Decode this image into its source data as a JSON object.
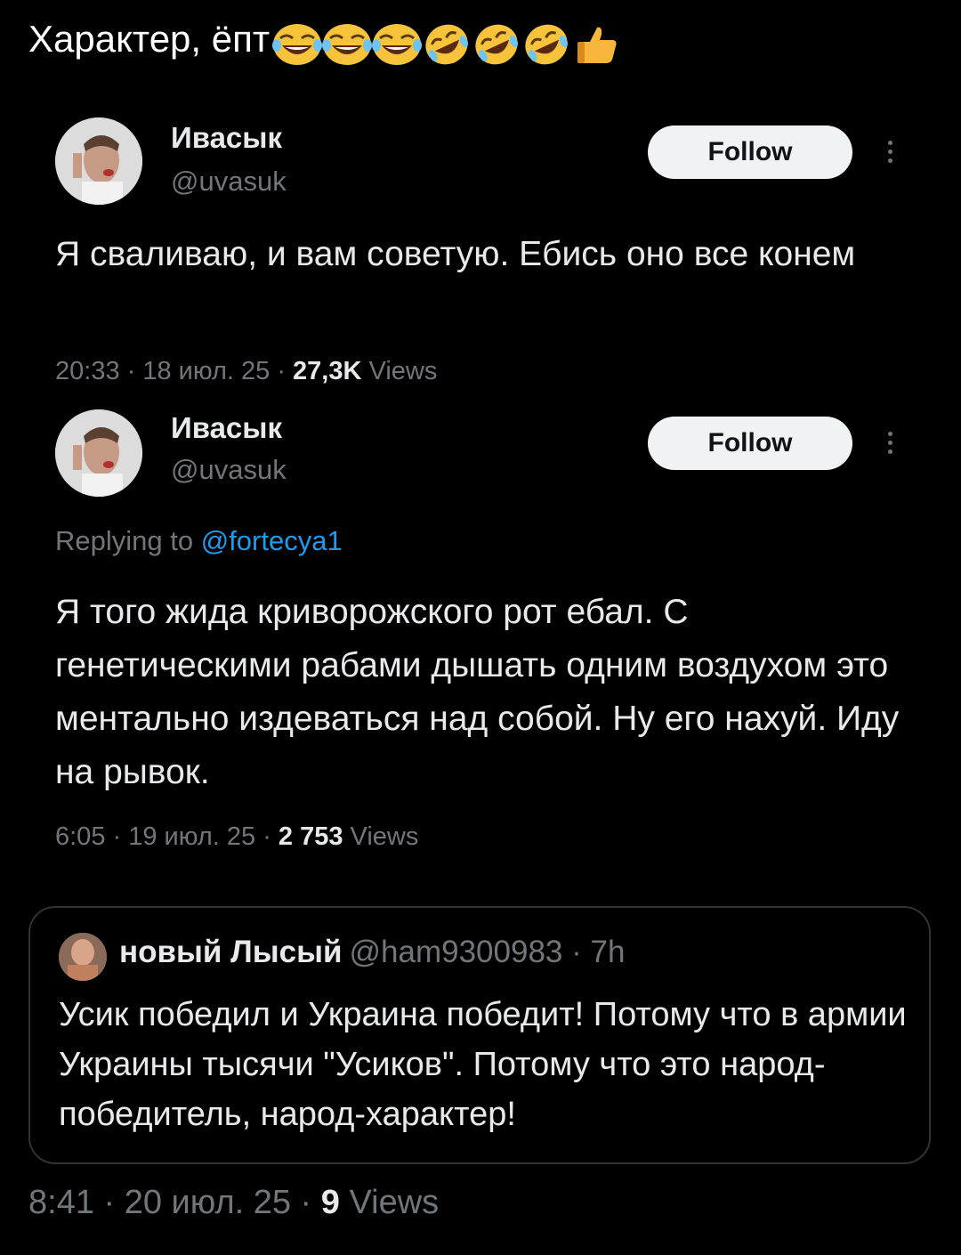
{
  "header": {
    "caption": "Характер, ёпт",
    "emojis": [
      "laughing-face-icon",
      "laughing-face-icon",
      "laughing-face-icon",
      "rofl-face-icon",
      "rofl-face-icon",
      "rofl-face-icon",
      "thumbs-up-icon"
    ]
  },
  "tweets": [
    {
      "name": "Ивасык",
      "handle": "@uvasuk",
      "follow_label": "Follow",
      "reply_prefix": "",
      "reply_mention": "",
      "text": "Я сваливаю, и вам советую. Ебись оно все конем",
      "time": "20:33 · 18 июл. 25 · ",
      "views_count": "27,3K",
      "views_label": " Views"
    },
    {
      "name": "Ивасык",
      "handle": "@uvasuk",
      "follow_label": "Follow",
      "reply_prefix": "Replying to ",
      "reply_mention": "@fortecya1",
      "text": "Я того жида криворожского рот ебал. С генетическими рабами дышать одним воздухом это ментально издеваться над собой. Ну его нахуй. Иду на рывок.",
      "time": "6:05 · 19 июл. 25 · ",
      "views_count": "2 753",
      "views_label": " Views"
    }
  ],
  "quote": {
    "name": "новый Лысый",
    "handle": "@ham9300983 · 7h",
    "text": "Усик победил и Украина победит! Потому что в армии Украины тысячи \"Усиков\". Потому что это народ-победитель, народ-характер!"
  },
  "footer": {
    "time": "8:41 · 20 июл. 25 · ",
    "views_count": "9",
    "views_label": " Views"
  },
  "colors": {
    "background": "#000000",
    "text": "#e7e9ea",
    "secondary": "#71767b",
    "link": "#1d9bf0",
    "button_bg": "#eff3f4"
  }
}
